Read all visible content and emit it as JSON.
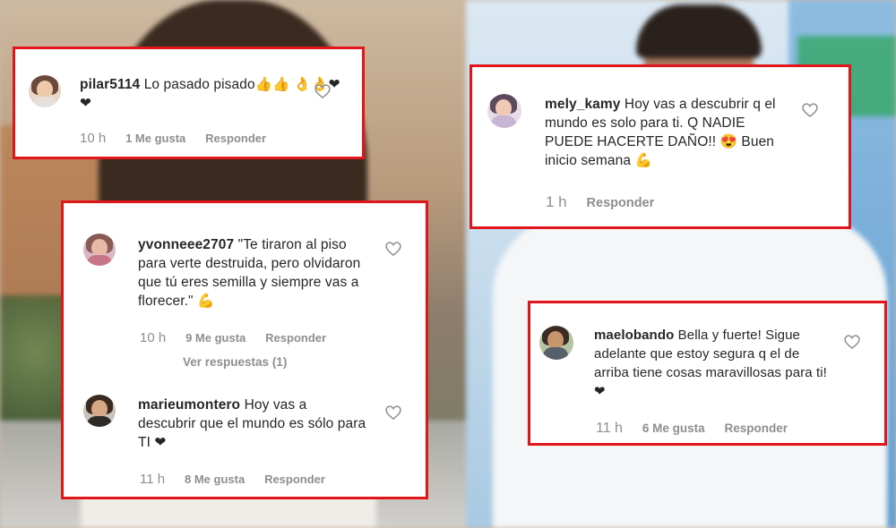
{
  "comments": [
    {
      "username": "pilar5114",
      "text": "Lo pasado pisado👍👍 👌👌❤❤",
      "time": "10 h",
      "likes": "1 Me gusta",
      "reply": "Responder"
    },
    {
      "username": "yvonneee2707",
      "text": "\"Te tiraron al piso para verte destruida, pero olvidaron que tú eres semilla y siempre vas a florecer.\" 💪",
      "time": "10 h",
      "likes": "9 Me gusta",
      "reply": "Responder",
      "view_replies": "Ver respuestas (1)"
    },
    {
      "username": "marieumontero",
      "text": "Hoy vas a descubrir que el mundo es sólo para TI ❤",
      "time": "11 h",
      "likes": "8 Me gusta",
      "reply": "Responder"
    },
    {
      "username": "mely_kamy",
      "text": "Hoy vas a descubrir q el mundo es solo para ti. Q NADIE PUEDE HACERTE DAÑO!! 😍 Buen inicio semana 💪",
      "time": "1 h",
      "reply": "Responder"
    },
    {
      "username": "maelobando",
      "text": "Bella y fuerte! Sigue adelante que estoy segura q el de arriba tiene cosas maravillosas para ti! ❤",
      "time": "11 h",
      "likes": "6 Me gusta",
      "reply": "Responder"
    }
  ],
  "colors": {
    "card_border": "#e0161b",
    "text": "#262626",
    "meta": "#8e8e8e"
  },
  "icons": [
    "heart-outline-icon",
    "avatar"
  ]
}
